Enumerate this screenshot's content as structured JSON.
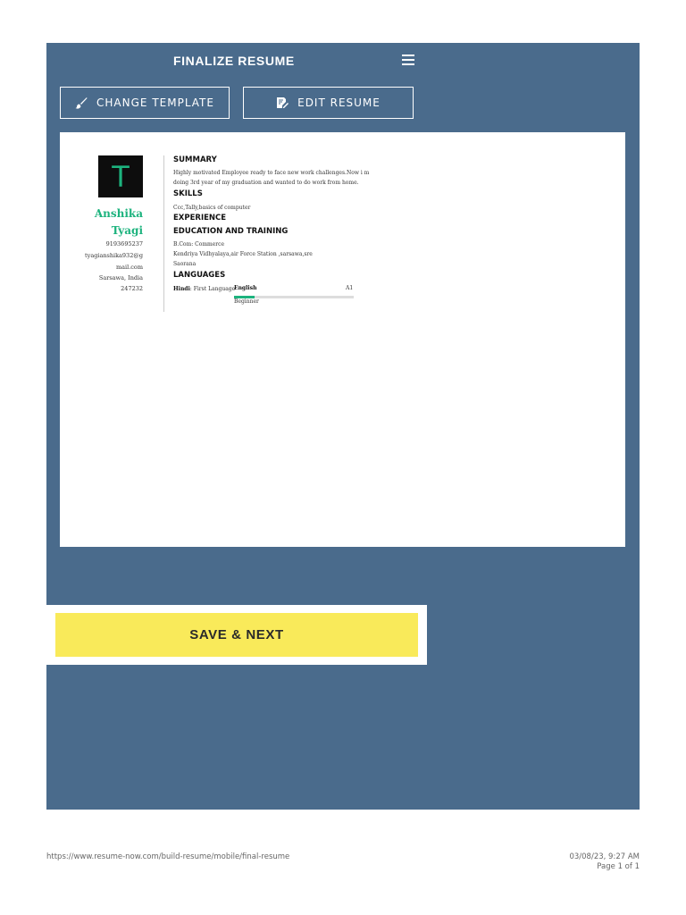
{
  "header": {
    "title": "FINALIZE RESUME",
    "menu_icon": "hamburger-menu-icon"
  },
  "actions": {
    "change_template_label": "CHANGE TEMPLATE",
    "change_template_icon": "paintbrush-icon",
    "edit_resume_label": "EDIT RESUME",
    "edit_resume_icon": "edit-document-icon"
  },
  "resume": {
    "initial": "T",
    "first_name": "Anshika",
    "last_name": "Tyagi",
    "phone": "9193695237",
    "email_line1": "tyagianshika932@g",
    "email_line2": "mail.com",
    "location": "Sarsawa, India",
    "zip": "247232",
    "sections": {
      "summary_heading": "SUMMARY",
      "summary_line1": "Highly motivated Employee ready to face new work challenges.Now i m",
      "summary_line2": "doing 3rd year of my graduation and wanted to do work from home.",
      "skills_heading": "SKILLS",
      "skills_text": "Ccc,Tally,basics of computer",
      "experience_heading": "EXPERIENCE",
      "education_heading": "EDUCATION AND TRAINING",
      "education_line1": "B.Com: Commerce",
      "education_line2": "Kendriya Vidhyalaya,air Force Station ,sarsawa,sre",
      "education_line3": "Saorana",
      "languages_heading": "LANGUAGES"
    },
    "languages": {
      "hindi_name": "Hindi",
      "hindi_level": ": First Language",
      "english_name": "English",
      "english_level_code": "A1",
      "english_level_word": "Beginner",
      "english_proficiency": 0.17
    }
  },
  "save": {
    "label": "SAVE & NEXT"
  },
  "footer": {
    "url": "https://www.resume-now.com/build-resume/mobile/final-resume",
    "timestamp": "03/08/23, 9:27 AM",
    "page": "Page 1 of 1"
  },
  "colors": {
    "panel_bg": "#4a6b8c",
    "accent_green": "#1db37e",
    "save_yellow": "#f9ea5a"
  }
}
